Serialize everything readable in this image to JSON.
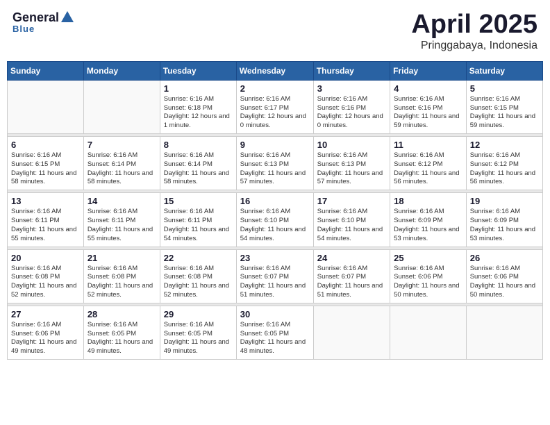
{
  "header": {
    "logo_general": "General",
    "logo_blue": "Blue",
    "month_year": "April 2025",
    "location": "Pringgabaya, Indonesia"
  },
  "weekdays": [
    "Sunday",
    "Monday",
    "Tuesday",
    "Wednesday",
    "Thursday",
    "Friday",
    "Saturday"
  ],
  "weeks": [
    [
      {
        "day": "",
        "info": ""
      },
      {
        "day": "",
        "info": ""
      },
      {
        "day": "1",
        "info": "Sunrise: 6:16 AM\nSunset: 6:18 PM\nDaylight: 12 hours\nand 1 minute."
      },
      {
        "day": "2",
        "info": "Sunrise: 6:16 AM\nSunset: 6:17 PM\nDaylight: 12 hours\nand 0 minutes."
      },
      {
        "day": "3",
        "info": "Sunrise: 6:16 AM\nSunset: 6:16 PM\nDaylight: 12 hours\nand 0 minutes."
      },
      {
        "day": "4",
        "info": "Sunrise: 6:16 AM\nSunset: 6:16 PM\nDaylight: 11 hours\nand 59 minutes."
      },
      {
        "day": "5",
        "info": "Sunrise: 6:16 AM\nSunset: 6:15 PM\nDaylight: 11 hours\nand 59 minutes."
      }
    ],
    [
      {
        "day": "6",
        "info": "Sunrise: 6:16 AM\nSunset: 6:15 PM\nDaylight: 11 hours\nand 58 minutes."
      },
      {
        "day": "7",
        "info": "Sunrise: 6:16 AM\nSunset: 6:14 PM\nDaylight: 11 hours\nand 58 minutes."
      },
      {
        "day": "8",
        "info": "Sunrise: 6:16 AM\nSunset: 6:14 PM\nDaylight: 11 hours\nand 58 minutes."
      },
      {
        "day": "9",
        "info": "Sunrise: 6:16 AM\nSunset: 6:13 PM\nDaylight: 11 hours\nand 57 minutes."
      },
      {
        "day": "10",
        "info": "Sunrise: 6:16 AM\nSunset: 6:13 PM\nDaylight: 11 hours\nand 57 minutes."
      },
      {
        "day": "11",
        "info": "Sunrise: 6:16 AM\nSunset: 6:12 PM\nDaylight: 11 hours\nand 56 minutes."
      },
      {
        "day": "12",
        "info": "Sunrise: 6:16 AM\nSunset: 6:12 PM\nDaylight: 11 hours\nand 56 minutes."
      }
    ],
    [
      {
        "day": "13",
        "info": "Sunrise: 6:16 AM\nSunset: 6:11 PM\nDaylight: 11 hours\nand 55 minutes."
      },
      {
        "day": "14",
        "info": "Sunrise: 6:16 AM\nSunset: 6:11 PM\nDaylight: 11 hours\nand 55 minutes."
      },
      {
        "day": "15",
        "info": "Sunrise: 6:16 AM\nSunset: 6:11 PM\nDaylight: 11 hours\nand 54 minutes."
      },
      {
        "day": "16",
        "info": "Sunrise: 6:16 AM\nSunset: 6:10 PM\nDaylight: 11 hours\nand 54 minutes."
      },
      {
        "day": "17",
        "info": "Sunrise: 6:16 AM\nSunset: 6:10 PM\nDaylight: 11 hours\nand 54 minutes."
      },
      {
        "day": "18",
        "info": "Sunrise: 6:16 AM\nSunset: 6:09 PM\nDaylight: 11 hours\nand 53 minutes."
      },
      {
        "day": "19",
        "info": "Sunrise: 6:16 AM\nSunset: 6:09 PM\nDaylight: 11 hours\nand 53 minutes."
      }
    ],
    [
      {
        "day": "20",
        "info": "Sunrise: 6:16 AM\nSunset: 6:08 PM\nDaylight: 11 hours\nand 52 minutes."
      },
      {
        "day": "21",
        "info": "Sunrise: 6:16 AM\nSunset: 6:08 PM\nDaylight: 11 hours\nand 52 minutes."
      },
      {
        "day": "22",
        "info": "Sunrise: 6:16 AM\nSunset: 6:08 PM\nDaylight: 11 hours\nand 52 minutes."
      },
      {
        "day": "23",
        "info": "Sunrise: 6:16 AM\nSunset: 6:07 PM\nDaylight: 11 hours\nand 51 minutes."
      },
      {
        "day": "24",
        "info": "Sunrise: 6:16 AM\nSunset: 6:07 PM\nDaylight: 11 hours\nand 51 minutes."
      },
      {
        "day": "25",
        "info": "Sunrise: 6:16 AM\nSunset: 6:06 PM\nDaylight: 11 hours\nand 50 minutes."
      },
      {
        "day": "26",
        "info": "Sunrise: 6:16 AM\nSunset: 6:06 PM\nDaylight: 11 hours\nand 50 minutes."
      }
    ],
    [
      {
        "day": "27",
        "info": "Sunrise: 6:16 AM\nSunset: 6:06 PM\nDaylight: 11 hours\nand 49 minutes."
      },
      {
        "day": "28",
        "info": "Sunrise: 6:16 AM\nSunset: 6:05 PM\nDaylight: 11 hours\nand 49 minutes."
      },
      {
        "day": "29",
        "info": "Sunrise: 6:16 AM\nSunset: 6:05 PM\nDaylight: 11 hours\nand 49 minutes."
      },
      {
        "day": "30",
        "info": "Sunrise: 6:16 AM\nSunset: 6:05 PM\nDaylight: 11 hours\nand 48 minutes."
      },
      {
        "day": "",
        "info": ""
      },
      {
        "day": "",
        "info": ""
      },
      {
        "day": "",
        "info": ""
      }
    ]
  ]
}
